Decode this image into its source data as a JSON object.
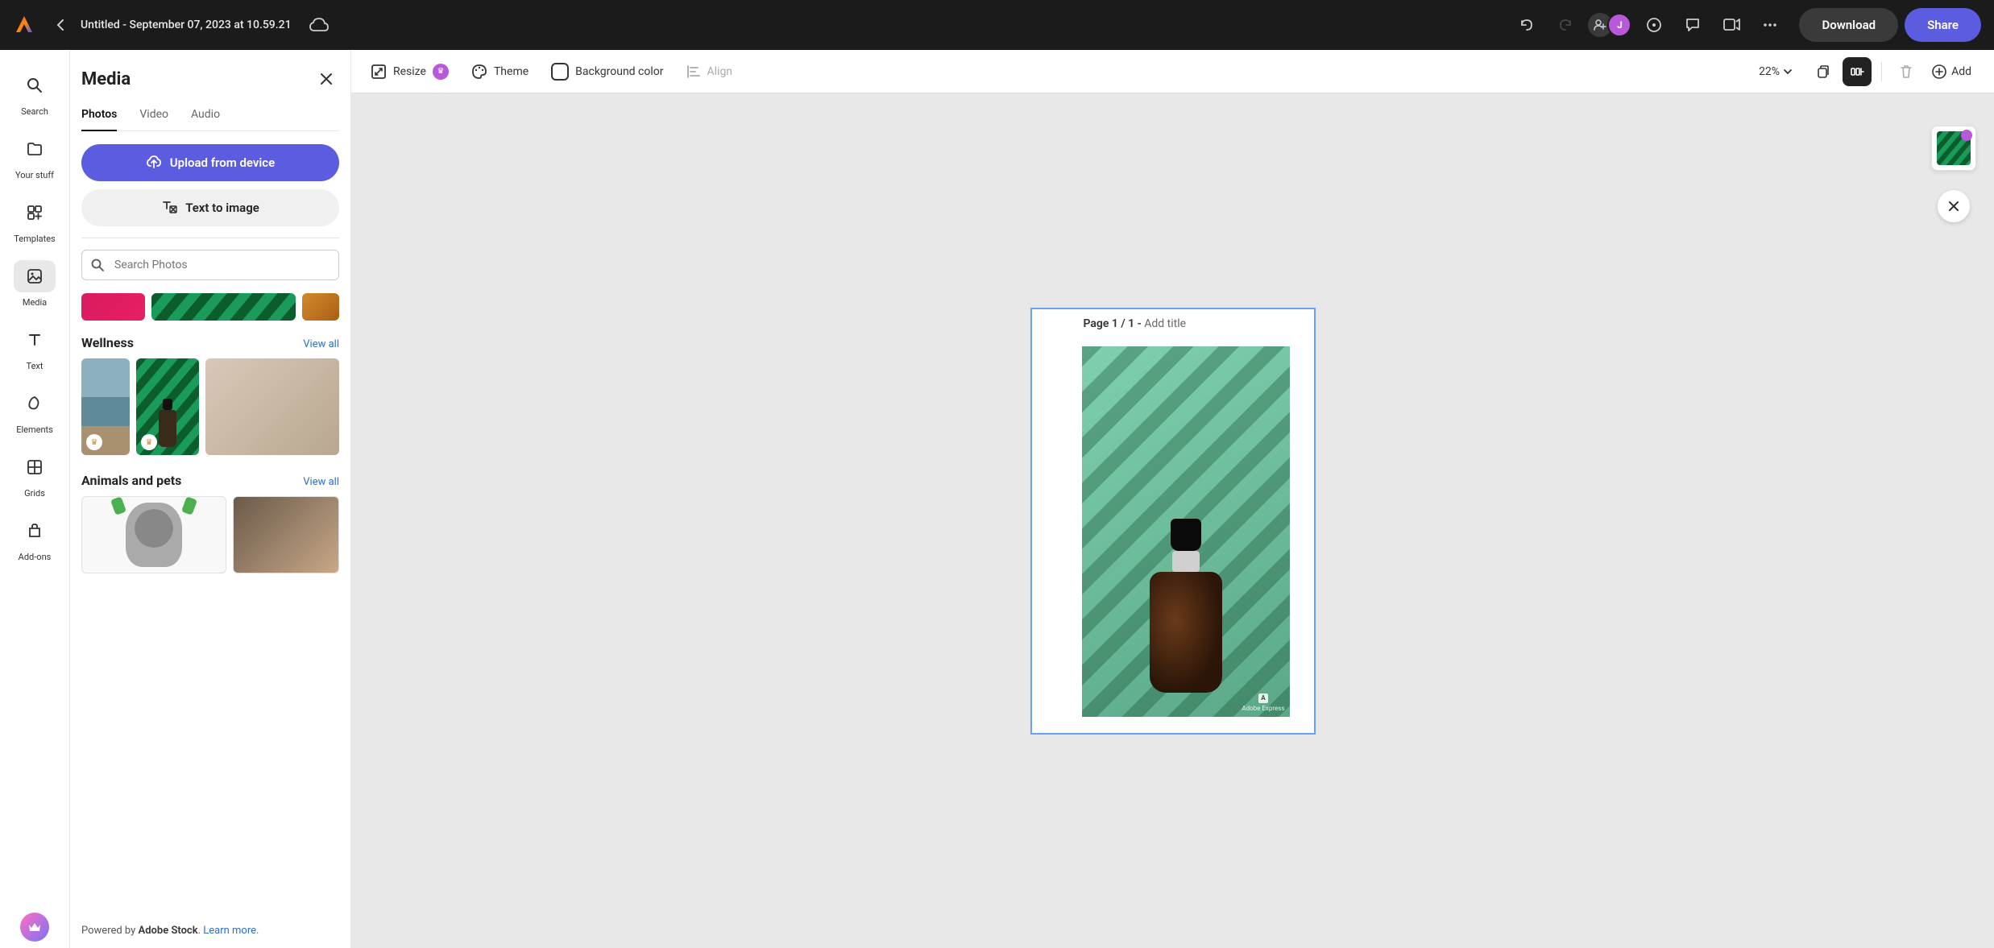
{
  "topbar": {
    "title": "Untitled - September 07, 2023 at 10.59.21",
    "avatar_initial": "J",
    "download_label": "Download",
    "share_label": "Share"
  },
  "rail": {
    "search": "Search",
    "your_stuff": "Your stuff",
    "templates": "Templates",
    "media": "Media",
    "text": "Text",
    "elements": "Elements",
    "grids": "Grids",
    "addons": "Add-ons"
  },
  "panel": {
    "title": "Media",
    "tabs": {
      "photos": "Photos",
      "video": "Video",
      "audio": "Audio"
    },
    "upload_label": "Upload from device",
    "t2i_label": "Text to image",
    "search_placeholder": "Search Photos",
    "sections": {
      "wellness": {
        "title": "Wellness",
        "view_all": "View all"
      },
      "animals": {
        "title": "Animals and pets",
        "view_all": "View all"
      }
    },
    "footer": {
      "prefix": "Powered by ",
      "brand": "Adobe Stock",
      "suffix": ". ",
      "link": "Learn more."
    }
  },
  "toolbar": {
    "resize": "Resize",
    "theme": "Theme",
    "background_color": "Background color",
    "align": "Align",
    "zoom": "22%",
    "add": "Add"
  },
  "canvas": {
    "page_prefix": "Page 1 / 1 - ",
    "page_title_hint": "Add title",
    "watermark": "Adobe Express",
    "watermark_initial": "A"
  }
}
